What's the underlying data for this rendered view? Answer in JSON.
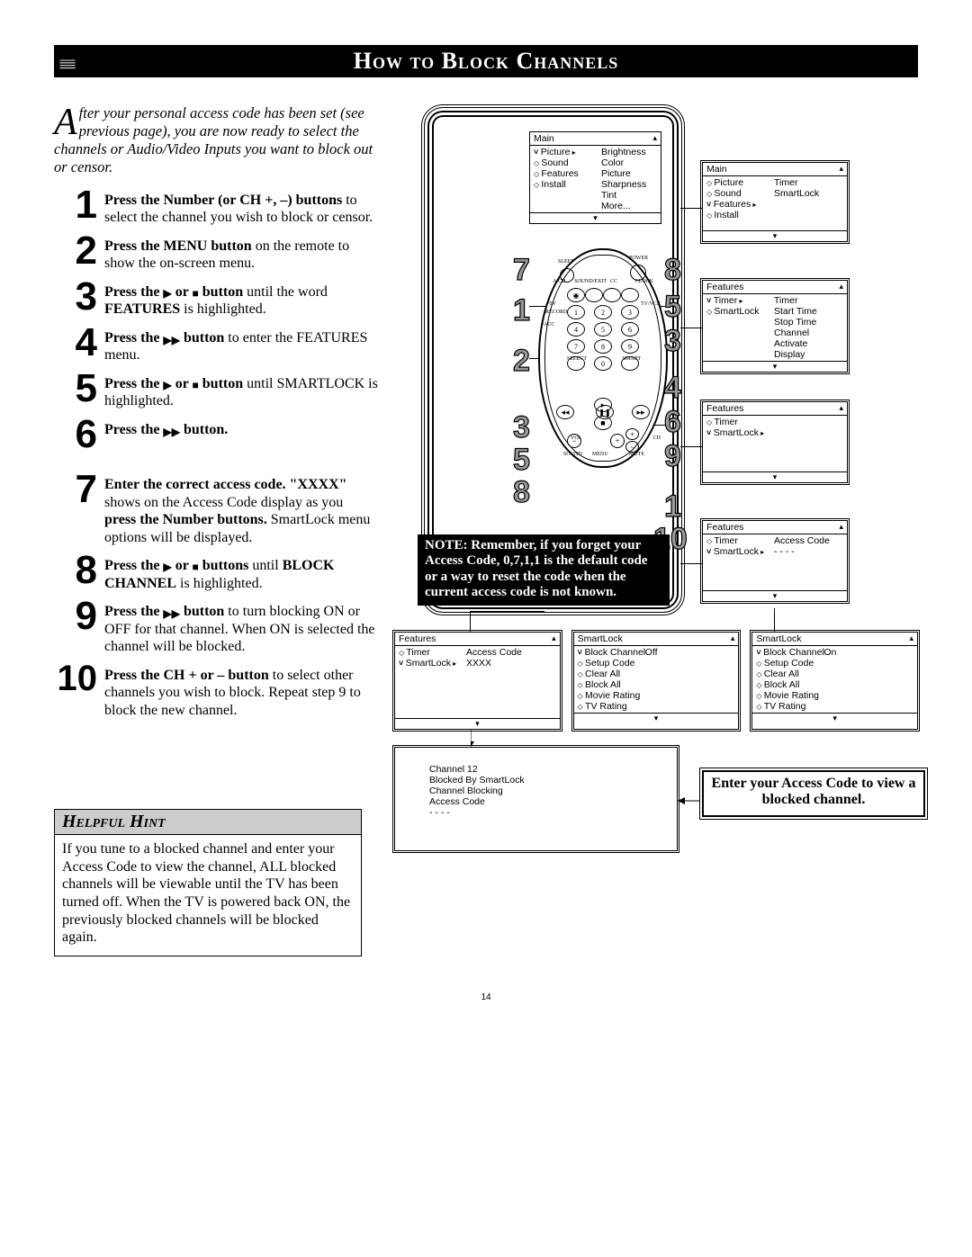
{
  "title": "How to Block Channels",
  "intro_drop": "A",
  "intro": "fter your personal access code has been set (see previous page), you are now ready to select the channels or Audio/Video Inputs you want to block out or censor.",
  "steps": [
    {
      "n": "1",
      "b1": "Press the Number (or CH +, –) buttons",
      "t": " to select the channel you wish to block or censor."
    },
    {
      "n": "2",
      "b1": "Press the MENU button",
      "t": " on the remote to show the on-screen menu."
    },
    {
      "n": "3",
      "b1": "Press the ▶ or ■ button",
      "t": " until the word ",
      "b2": "FEATURES",
      "t2": " is highlighted."
    },
    {
      "n": "4",
      "b1": "Press the ▶▶ button",
      "t": " to enter the FEATURES menu."
    },
    {
      "n": "5",
      "b1": "Press the ▶ or ■ button",
      "t": " until SMARTLOCK is highlighted."
    },
    {
      "n": "6",
      "b1": "Press the ▶▶ button.",
      "t": ""
    },
    {
      "n": "7",
      "b1": "Enter the correct access code. \"XXXX\"",
      "t": " shows on the Access Code display as you ",
      "b2": "press the Number buttons.",
      "t2": " SmartLock menu options will be displayed."
    },
    {
      "n": "8",
      "b1": "Press the ▶ or ■ buttons",
      "t": " until ",
      "b2": "BLOCK CHANNEL",
      "t2": " is highlighted."
    },
    {
      "n": "9",
      "b1": "Press the ▶▶ button",
      "t": " to turn blocking ON or OFF for that channel. When ON is selected the channel will be blocked."
    },
    {
      "n": "10",
      "b1": "Press the CH + or – button",
      "t": " to select other channels you wish to block. Repeat step 9 to block the new channel."
    }
  ],
  "hint": {
    "title": "Helpful Hint",
    "body": "If you tune to a blocked channel and enter your Access Code to view the channel, ALL blocked channels will be viewable until the TV has been turned off. When the TV is powered back ON, the previously blocked channels will be blocked again."
  },
  "note": "NOTE: Remember, if you forget your Access Code, 0,7,1,1 is the default code or a way to reset the code when the current access code is not known.",
  "enter_code_msg": "Enter your Access Code to view a blocked channel.",
  "screens": {
    "main1": {
      "title": "Main",
      "rows": [
        {
          "c1": "Picture",
          "mark": "sel tri",
          "c2": "Brightness"
        },
        {
          "c1": "Sound",
          "mark": "bullet",
          "c2": "Color"
        },
        {
          "c1": "Features",
          "mark": "bullet",
          "c2": "Picture"
        },
        {
          "c1": "Install",
          "mark": "bullet",
          "c2": "Sharpness"
        },
        {
          "c1": "",
          "mark": "",
          "c2": "Tint"
        },
        {
          "c1": "",
          "mark": "",
          "c2": "More..."
        }
      ]
    },
    "main2": {
      "title": "Main",
      "rows": [
        {
          "c1": "Picture",
          "mark": "bullet",
          "c2": "Timer"
        },
        {
          "c1": "Sound",
          "mark": "bullet",
          "c2": "SmartLock"
        },
        {
          "c1": "Features",
          "mark": "sel tri",
          "c2": ""
        },
        {
          "c1": "Install",
          "mark": "bullet",
          "c2": ""
        }
      ]
    },
    "feat1": {
      "title": "Features",
      "rows": [
        {
          "c1": "Timer",
          "mark": "sel tri",
          "c2": "Timer"
        },
        {
          "c1": "SmartLock",
          "mark": "bullet",
          "c2": "Start Time"
        },
        {
          "c1": "",
          "mark": "",
          "c2": "Stop Time"
        },
        {
          "c1": "",
          "mark": "",
          "c2": "Channel"
        },
        {
          "c1": "",
          "mark": "",
          "c2": "Activate"
        },
        {
          "c1": "",
          "mark": "",
          "c2": "Display"
        }
      ]
    },
    "feat2": {
      "title": "Features",
      "rows": [
        {
          "c1": "Timer",
          "mark": "bullet",
          "c2": ""
        },
        {
          "c1": "SmartLock",
          "mark": "sel tri",
          "c2": ""
        }
      ]
    },
    "feat3": {
      "title": "Features",
      "rows": [
        {
          "c1": "Timer",
          "mark": "bullet",
          "c2": "Access Code"
        },
        {
          "c1": "SmartLock",
          "mark": "sel tri",
          "c2": "- - - -"
        }
      ]
    },
    "feat4": {
      "title": "Features",
      "rows": [
        {
          "c1": "Timer",
          "mark": "bullet",
          "c2": "Access Code"
        },
        {
          "c1": "SmartLock",
          "mark": "sel tri",
          "c2": "XXXX"
        }
      ]
    },
    "sl_off": {
      "title": "SmartLock",
      "rows": [
        {
          "c1": "Block Channel",
          "mark": "sel",
          "c2": "Off"
        },
        {
          "c1": "Setup Code",
          "mark": "bullet",
          "c2": ""
        },
        {
          "c1": "Clear All",
          "mark": "bullet",
          "c2": ""
        },
        {
          "c1": "Block All",
          "mark": "bullet",
          "c2": ""
        },
        {
          "c1": "Movie Rating",
          "mark": "bullet",
          "c2": ""
        },
        {
          "c1": "TV Rating",
          "mark": "bullet",
          "c2": ""
        }
      ]
    },
    "sl_on": {
      "title": "SmartLock",
      "rows": [
        {
          "c1": "Block Channel",
          "mark": "sel",
          "c2": "On"
        },
        {
          "c1": "Setup Code",
          "mark": "bullet",
          "c2": ""
        },
        {
          "c1": "Clear All",
          "mark": "bullet",
          "c2": ""
        },
        {
          "c1": "Block All",
          "mark": "bullet",
          "c2": ""
        },
        {
          "c1": "Movie Rating",
          "mark": "bullet",
          "c2": ""
        },
        {
          "c1": "TV Rating",
          "mark": "bullet",
          "c2": ""
        }
      ]
    },
    "blocked": [
      "Channel 12",
      "Blocked By SmartLock",
      "Channel Blocking",
      "Access Code",
      "- - - -"
    ]
  },
  "callouts": {
    "remote_left": [
      "7",
      "1",
      "2",
      "3",
      "5",
      "8"
    ],
    "remote_right": [
      "8",
      "5",
      "3",
      "4",
      "6",
      "9",
      "1",
      "10"
    ]
  },
  "page_num": "14"
}
